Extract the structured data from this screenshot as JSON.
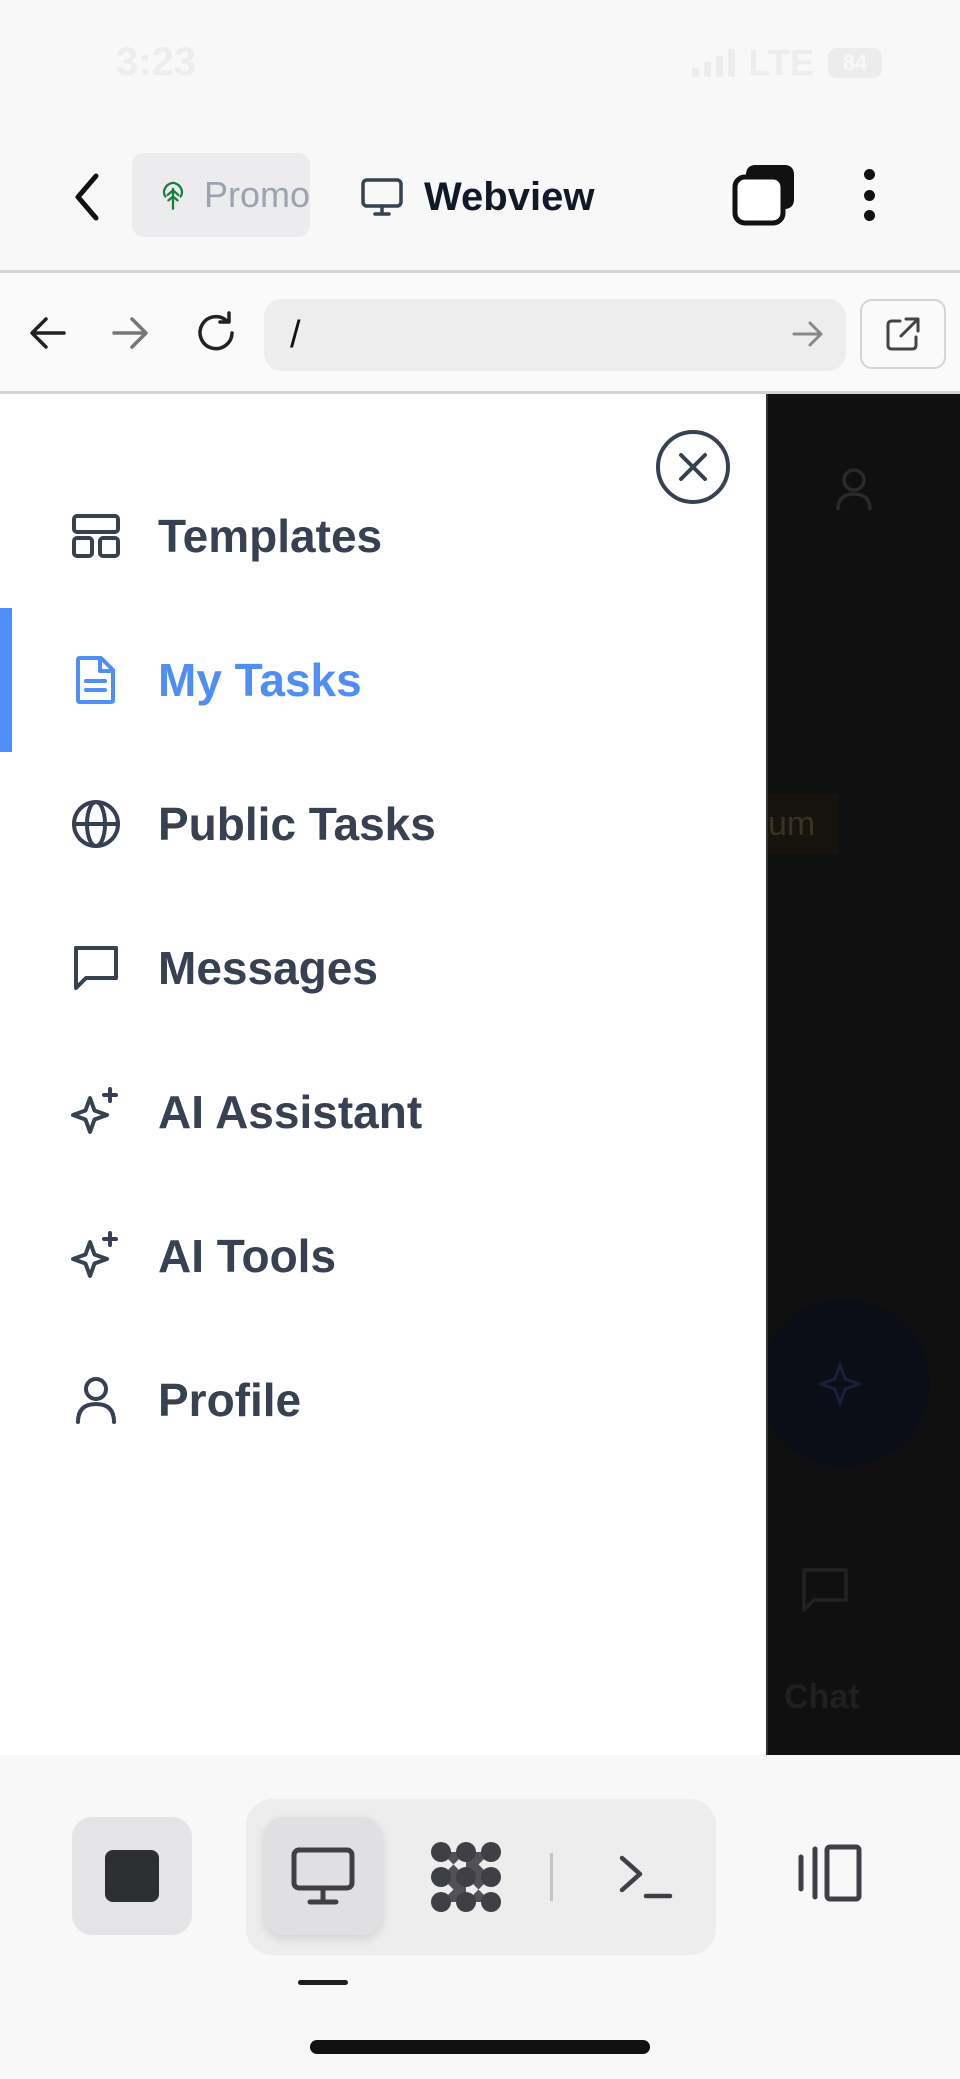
{
  "status_bar": {
    "time": "3:23",
    "network": "LTE",
    "battery": "84"
  },
  "header": {
    "promo_tab_label": "Promo",
    "webview_tab_label": "Webview"
  },
  "browser": {
    "url_value": "/"
  },
  "drawer": {
    "items": [
      {
        "label": "Templates",
        "icon": "layout-icon",
        "active": false
      },
      {
        "label": "My Tasks",
        "icon": "document-icon",
        "active": true
      },
      {
        "label": "Public Tasks",
        "icon": "globe-icon",
        "active": false
      },
      {
        "label": "Messages",
        "icon": "message-icon",
        "active": false
      },
      {
        "label": "AI Assistant",
        "icon": "sparkles-icon",
        "active": false
      },
      {
        "label": "AI Tools",
        "icon": "sparkles-icon",
        "active": false
      },
      {
        "label": "Profile",
        "icon": "user-icon",
        "active": false
      }
    ]
  },
  "background_page": {
    "premium_fragment": "um",
    "chat_label": "Chat"
  },
  "colors": {
    "accent": "#4f8ef7",
    "menu_text": "#374151",
    "overlay": "#101010"
  }
}
